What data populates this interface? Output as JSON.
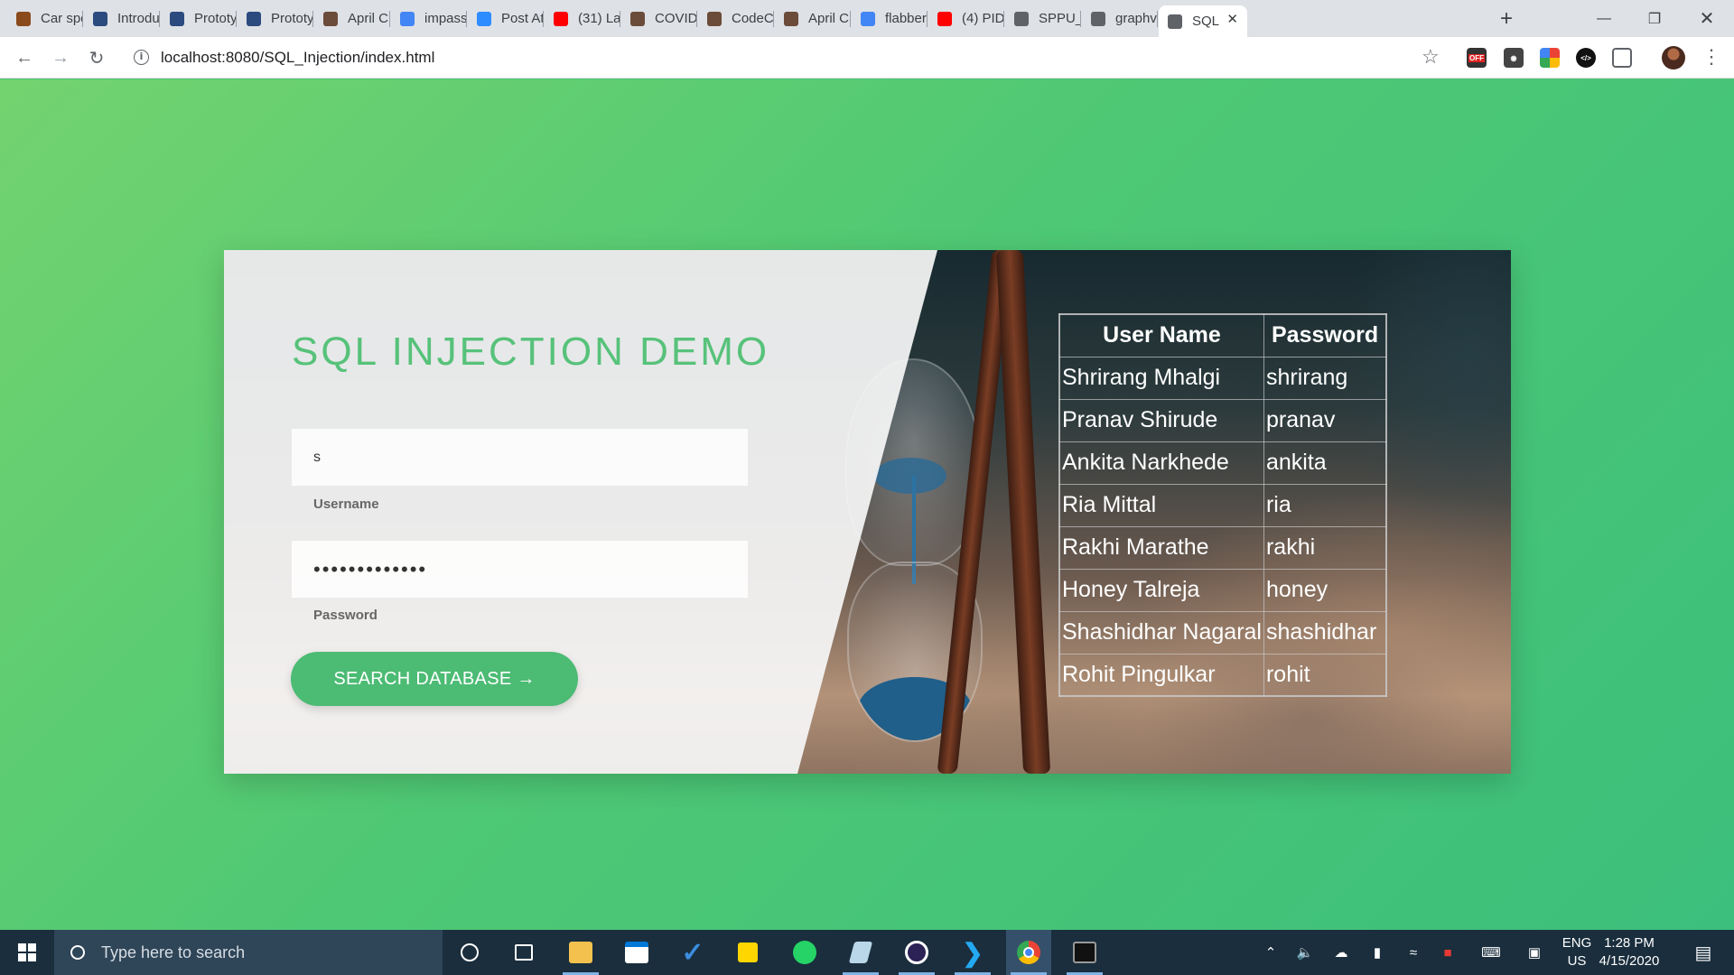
{
  "browser": {
    "tabs": [
      {
        "label": "Car spe",
        "favicon": "github-icon",
        "color": "#8a4a1c"
      },
      {
        "label": "Introdu",
        "favicon": "tds-icon",
        "color": "#2b4b7e"
      },
      {
        "label": "Prototy",
        "favicon": "tds-icon",
        "color": "#2b4b7e"
      },
      {
        "label": "Prototy",
        "favicon": "tds-icon",
        "color": "#2b4b7e"
      },
      {
        "label": "April Ch",
        "favicon": "codechef-icon",
        "color": "#6b4b3a"
      },
      {
        "label": "impasse",
        "favicon": "google-icon",
        "color": "#4285f4"
      },
      {
        "label": "Post Att",
        "favicon": "zoom-icon",
        "color": "#2d8cff"
      },
      {
        "label": "(31) La",
        "favicon": "youtube-icon",
        "color": "#ff0000"
      },
      {
        "label": "COVID",
        "favicon": "codechef-icon",
        "color": "#6b4b3a"
      },
      {
        "label": "CodeCh",
        "favicon": "codechef-icon",
        "color": "#6b4b3a"
      },
      {
        "label": "April Ch",
        "favicon": "codechef-icon",
        "color": "#6b4b3a"
      },
      {
        "label": "flabberg",
        "favicon": "google-icon",
        "color": "#4285f4"
      },
      {
        "label": "(4) PID",
        "favicon": "youtube-icon",
        "color": "#ff0000"
      },
      {
        "label": "SPPU_B",
        "favicon": "globe-icon",
        "color": "#5f6368"
      },
      {
        "label": "graphvi",
        "favicon": "globe-icon",
        "color": "#5f6368"
      },
      {
        "label": "SQL",
        "favicon": "globe-icon",
        "color": "#5f6368",
        "active": true
      }
    ],
    "url": "localhost:8080/SQL_Injection/index.html"
  },
  "page": {
    "title": "SQL INJECTION DEMO",
    "username_value": "s",
    "username_label": "Username",
    "password_value": "•••••••••••••",
    "password_label": "Password",
    "search_button": "SEARCH DATABASE →"
  },
  "results_table": {
    "headers": [
      "User Name",
      "Password"
    ],
    "rows": [
      [
        "Shrirang Mhalgi",
        "shrirang"
      ],
      [
        "Pranav Shirude",
        "pranav"
      ],
      [
        "Ankita Narkhede",
        "ankita"
      ],
      [
        "Ria Mittal",
        "ria"
      ],
      [
        "Rakhi Marathe",
        "rakhi"
      ],
      [
        "Honey Talreja",
        "honey"
      ],
      [
        "Shashidhar Nagaral",
        "shashidhar"
      ],
      [
        "Rohit Pingulkar",
        "rohit"
      ]
    ]
  },
  "taskbar": {
    "search_placeholder": "Type here to search",
    "language_line1": "ENG",
    "language_line2": "US",
    "time": "1:28 PM",
    "date": "4/15/2020"
  },
  "colors": {
    "accent_green": "#4cbb74",
    "title_green": "#57c27a",
    "background_green": "#4ec874"
  }
}
